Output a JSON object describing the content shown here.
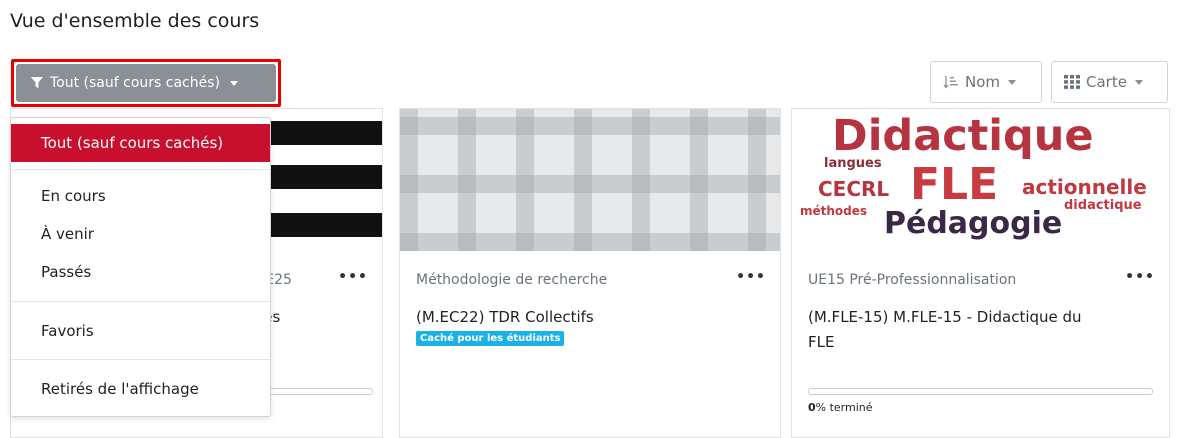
{
  "page": {
    "title": "Vue d'ensemble des cours"
  },
  "filter": {
    "label": "Tout (sauf cours cachés)",
    "icon": "filter-icon",
    "highlight_color": "#e60000",
    "button_color": "#8a9096"
  },
  "sort": {
    "label": "Nom",
    "icon": "sort-icon"
  },
  "view": {
    "label": "Carte",
    "icon": "grid-icon"
  },
  "menu": {
    "active_color": "#c8102e",
    "items": [
      {
        "label": "Tout (sauf cours cachés)",
        "selected": true
      },
      {
        "label": "En cours"
      },
      {
        "label": "À venir"
      },
      {
        "label": "Passés"
      },
      {
        "label": "Favoris"
      },
      {
        "label": "Retirés de l'affichage"
      }
    ]
  },
  "cards": [
    {
      "category_visible": "UE25",
      "name_visible": "ces",
      "menu_label": "•••"
    },
    {
      "category": "Méthodologie de recherche",
      "name": "(M.EC22) TDR Collectifs",
      "badge": "Caché pour les étudiants",
      "badge_color": "#1ab0e8",
      "menu_label": "•••"
    },
    {
      "category": "UE15 Pré-Professionnalisation",
      "name_line1": "(M.FLE-15) M.FLE-15 - Didactique du",
      "name_line2": "FLE",
      "menu_label": "•••",
      "progress_value": "0",
      "progress_suffix": "% terminé",
      "progress_fraction": 0,
      "wordcloud": {
        "words": [
          "Didactique",
          "FLE",
          "CECRL",
          "actionnelle",
          "didactique",
          "langues",
          "méthodes",
          "Pédagogie"
        ]
      }
    }
  ]
}
